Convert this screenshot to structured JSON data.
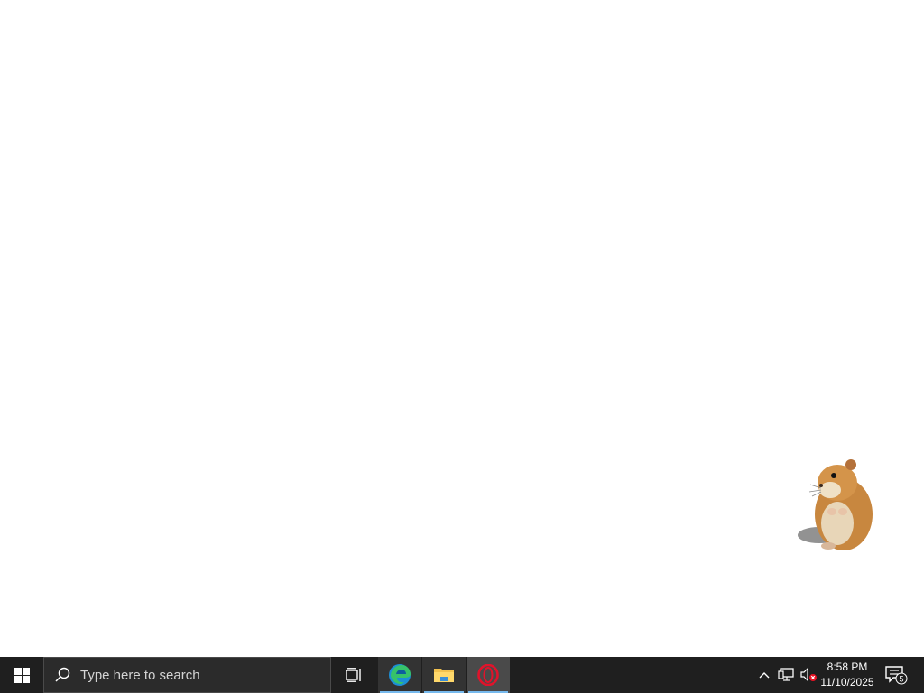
{
  "desktop": {
    "background": "#ffffff",
    "pet": "hamster"
  },
  "taskbar": {
    "background": "#1f1f1f",
    "start_icon": "windows-logo-icon",
    "search_placeholder": "Type here to search",
    "search_icon": "search-icon",
    "task_view_icon": "task-view-icon",
    "pinned_apps": [
      {
        "name": "Microsoft Edge",
        "icon": "edge-icon",
        "running": true
      },
      {
        "name": "File Explorer",
        "icon": "folder-icon",
        "running": true
      },
      {
        "name": "Opera",
        "icon": "opera-icon",
        "running": true,
        "active": true
      }
    ],
    "tray": {
      "chevron_icon": "chevron-up-icon",
      "network_icon": "network-icon",
      "volume_icon": "volume-muted-icon",
      "time": "8:58 PM",
      "date": "11/10/2025",
      "notification_count": "5"
    },
    "accent": "#76b9ed"
  }
}
